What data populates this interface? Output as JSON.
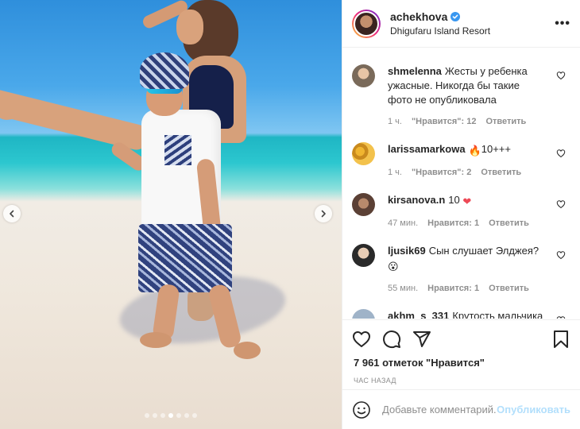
{
  "post": {
    "username": "achekhova",
    "location": "Dhigufaru Island Resort",
    "more_icon": "more-horizontal-icon",
    "likes_text": "7 961 отметок \"Нравится\"",
    "time_ago": "ЧАС НАЗАД"
  },
  "carousel": {
    "dots_count": 7,
    "active_dot": 3,
    "prev_icon": "chevron-left-icon",
    "next_icon": "chevron-right-icon"
  },
  "comments": [
    {
      "username": "shmelenna",
      "text": "Жесты у ребенка ужасные. Никогда бы такие фото не опубликовала",
      "emoji": "",
      "time": "1 ч.",
      "likes": "\"Нравится\": 12",
      "reply": "Ответить"
    },
    {
      "username": "larissamarkowa",
      "text": "10+++",
      "emoji": "🔥",
      "time": "1 ч.",
      "likes": "\"Нравится\": 2",
      "reply": "Ответить"
    },
    {
      "username": "kirsanova.n",
      "text": "10",
      "emoji": "❤",
      "time": "47 мин.",
      "likes": "Нравится: 1",
      "reply": "Ответить"
    },
    {
      "username": "ljusik69",
      "text": "Сын слушает Элджея?",
      "emoji": "😮",
      "time": "55 мин.",
      "likes": "Нравится: 1",
      "reply": "Ответить"
    },
    {
      "username": "akhm_s_331",
      "text": "Крутость мальчика",
      "emoji": "",
      "time": "",
      "likes": "",
      "reply": ""
    }
  ],
  "add_comment": {
    "placeholder": "Добавьте комментарий...",
    "publish_label": "Опубликовать"
  },
  "colors": {
    "verified": "#3897f0",
    "heart_red": "#ed4956",
    "publish_disabled": "#b2dffc",
    "muted_text": "#8e8e8e"
  }
}
